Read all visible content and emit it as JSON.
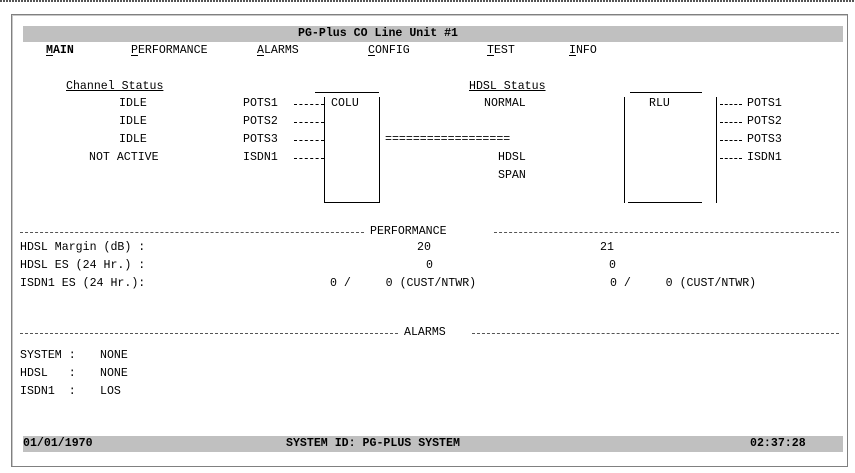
{
  "window": {
    "title": "PG-Plus CO Line Unit #1"
  },
  "menu": [
    {
      "hotkey": "M",
      "rest": "AIN"
    },
    {
      "hotkey": "P",
      "rest": "ERFORMANCE"
    },
    {
      "hotkey": "A",
      "rest": "LARMS"
    },
    {
      "hotkey": "C",
      "rest": "ONFIG"
    },
    {
      "hotkey": "T",
      "rest": "EST"
    },
    {
      "hotkey": "I",
      "rest": "NFO"
    }
  ],
  "channel_status": {
    "heading": "Channel Status",
    "rows": [
      {
        "state": "IDLE",
        "port": "POTS1"
      },
      {
        "state": "IDLE",
        "port": "POTS2"
      },
      {
        "state": "IDLE",
        "port": "POTS3"
      },
      {
        "state": "NOT ACTIVE",
        "port": "ISDN1"
      }
    ]
  },
  "hdsl_status": {
    "heading": "HDSL Status",
    "value": "NORMAL",
    "link": "==================",
    "span_line1": "HDSL",
    "span_line2": "SPAN"
  },
  "colu_label": "COLU",
  "rlu": {
    "label": "RLU",
    "ports": [
      "POTS1",
      "POTS2",
      "POTS3",
      "ISDN1"
    ]
  },
  "performance": {
    "heading": "PERFORMANCE",
    "rows": [
      {
        "label": "HDSL Margin (dB) :",
        "colu": "20",
        "rlu": "21"
      },
      {
        "label": "HDSL ES (24 Hr.) :",
        "colu": "0",
        "rlu": "0"
      },
      {
        "label": "ISDN1 ES (24 Hr.):",
        "colu": "0 /     0 (CUST/NTWR)",
        "rlu": "0 /     0 (CUST/NTWR)"
      }
    ]
  },
  "alarms": {
    "heading": "ALARMS",
    "rows": [
      {
        "label": "SYSTEM :",
        "value": "NONE"
      },
      {
        "label": "HDSL   :",
        "value": "NONE"
      },
      {
        "label": "ISDN1  :",
        "value": "LOS"
      }
    ]
  },
  "status_bar": {
    "date": "01/01/1970",
    "system_id": "SYSTEM ID: PG-PLUS SYSTEM",
    "time": "02:37:28"
  }
}
